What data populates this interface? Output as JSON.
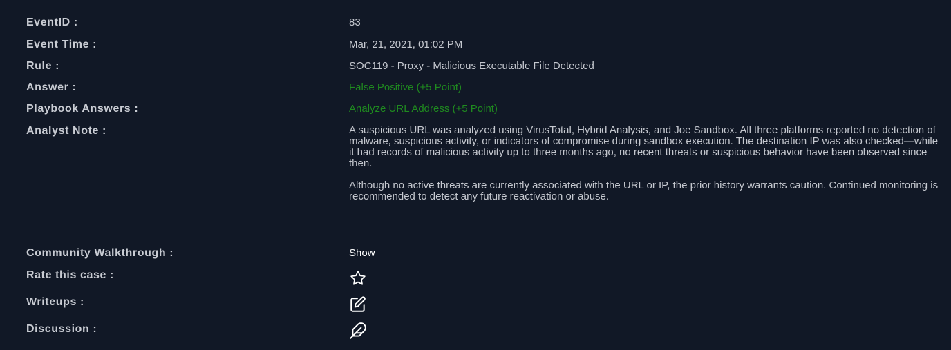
{
  "labels": {
    "event_id": "EventID :",
    "event_time": "Event Time :",
    "rule": "Rule :",
    "answer": "Answer :",
    "playbook_answers": "Playbook Answers :",
    "analyst_note": "Analyst Note :",
    "community_walkthrough": "Community Walkthrough :",
    "rate_this_case": "Rate this case :",
    "writeups": "Writeups :",
    "discussion": "Discussion :"
  },
  "values": {
    "event_id": "83",
    "event_time": "Mar, 21, 2021, 01:02 PM",
    "rule": "SOC119 - Proxy - Malicious Executable File Detected",
    "answer": "False Positive (+5 Point)",
    "playbook_answers": "Analyze URL Address (+5 Point)",
    "analyst_note_p1": "A suspicious URL was analyzed using VirusTotal, Hybrid Analysis, and Joe Sandbox. All three platforms reported no detection of malware, suspicious activity, or indicators of compromise during sandbox execution. The destination IP was also checked—while it had records of malicious activity up to three months ago, no recent threats or suspicious behavior have been observed since then.",
    "analyst_note_p2": "Although no active threats are currently associated with the URL or IP, the prior history warrants caution. Continued monitoring is recommended to detect any future reactivation or abuse.",
    "community_walkthrough": "Show"
  },
  "icons": {
    "rate": "star-icon",
    "writeups": "edit-icon",
    "discussion": "feather-icon"
  },
  "colors": {
    "background": "#111826",
    "label": "#c9ccd3",
    "value": "#c5c8cf",
    "success": "#1f8a1f"
  }
}
